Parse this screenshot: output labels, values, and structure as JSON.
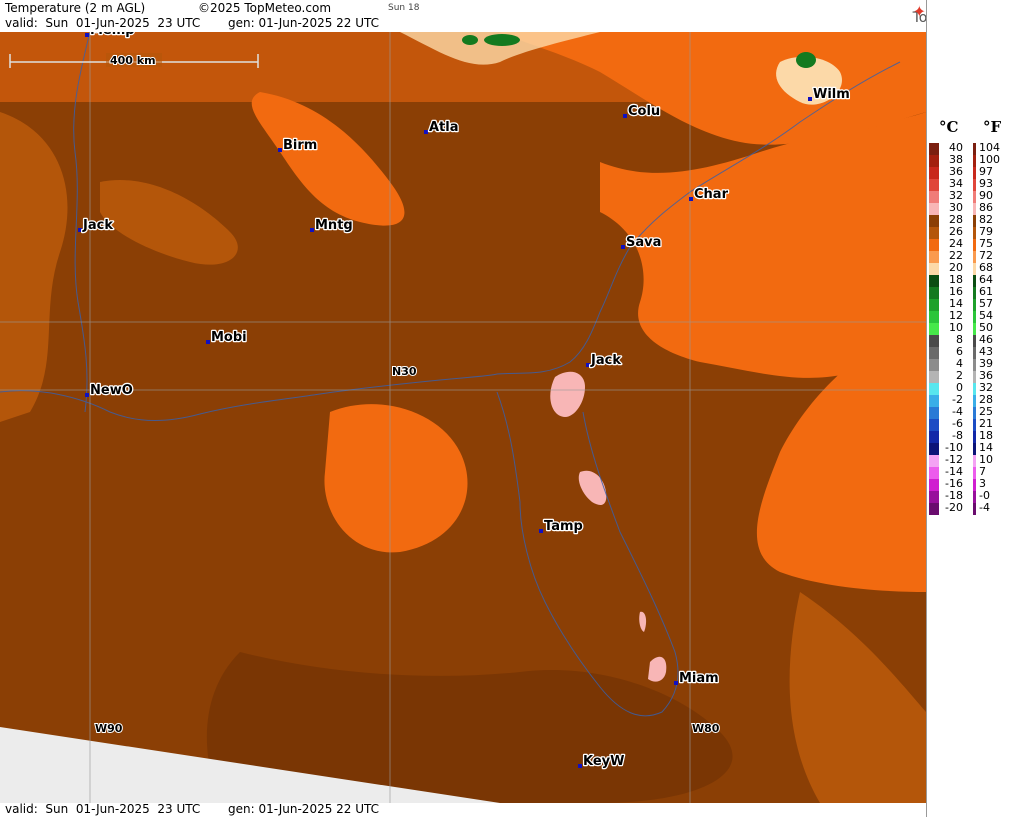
{
  "header": {
    "title": "Temperature (2 m AGL)",
    "copyright": "©2025 TopMeteo.com",
    "run": "Sun 18",
    "valid": "valid:  Sun  01-Jun-2025  23 UTC",
    "gen": "gen: 01-Jun-2025 22 UTC",
    "brand": "TopMeteo"
  },
  "footer": {
    "valid": "valid:  Sun  01-Jun-2025  23 UTC",
    "gen": "gen: 01-Jun-2025 22 UTC"
  },
  "map": {
    "scale_label": "400 km",
    "grid_labels": {
      "lat": "N30",
      "lon_w90": "W90",
      "lon_w80": "W80"
    },
    "cities": [
      {
        "name": "Memp"
      },
      {
        "name": "Birm"
      },
      {
        "name": "Atla"
      },
      {
        "name": "Colu"
      },
      {
        "name": "Wilm"
      },
      {
        "name": "Jack"
      },
      {
        "name": "Mntg"
      },
      {
        "name": "Char"
      },
      {
        "name": "Sava"
      },
      {
        "name": "Mobi"
      },
      {
        "name": "Jack"
      },
      {
        "name": "N30"
      },
      {
        "name": "NewO"
      },
      {
        "name": "Tamp"
      },
      {
        "name": "Miam"
      },
      {
        "name": "KeyW"
      }
    ]
  },
  "legend": {
    "celsius_label": "°C",
    "fahrenheit_label": "°F",
    "rows": [
      {
        "c": "40",
        "f": "104",
        "color": "#7b1f10"
      },
      {
        "c": "38",
        "f": "100",
        "color": "#a3200f"
      },
      {
        "c": "36",
        "f": "97",
        "color": "#c8281c"
      },
      {
        "c": "34",
        "f": "93",
        "color": "#e0463a"
      },
      {
        "c": "32",
        "f": "90",
        "color": "#f07c78"
      },
      {
        "c": "30",
        "f": "86",
        "color": "#f8b6b6"
      },
      {
        "c": "28",
        "f": "82",
        "color": "#8b3f05"
      },
      {
        "c": "26",
        "f": "79",
        "color": "#b4560a"
      },
      {
        "c": "24",
        "f": "75",
        "color": "#f26a10"
      },
      {
        "c": "22",
        "f": "72",
        "color": "#fa9a4e"
      },
      {
        "c": "20",
        "f": "68",
        "color": "#fcd9a8"
      },
      {
        "c": "18",
        "f": "64",
        "color": "#0b4d12"
      },
      {
        "c": "16",
        "f": "61",
        "color": "#147a1f"
      },
      {
        "c": "14",
        "f": "57",
        "color": "#1ea12b"
      },
      {
        "c": "12",
        "f": "54",
        "color": "#2bc53a"
      },
      {
        "c": "10",
        "f": "50",
        "color": "#46e84a"
      },
      {
        "c": "8",
        "f": "46",
        "color": "#4a4a4a"
      },
      {
        "c": "6",
        "f": "43",
        "color": "#6a6a6a"
      },
      {
        "c": "4",
        "f": "39",
        "color": "#8c8c8c"
      },
      {
        "c": "2",
        "f": "36",
        "color": "#b4b4b4"
      },
      {
        "c": "0",
        "f": "32",
        "color": "#58e6ee"
      },
      {
        "c": "-2",
        "f": "28",
        "color": "#3aaee8"
      },
      {
        "c": "-4",
        "f": "25",
        "color": "#2a7ad6"
      },
      {
        "c": "-6",
        "f": "21",
        "color": "#1c4cc4"
      },
      {
        "c": "-8",
        "f": "18",
        "color": "#1228a8"
      },
      {
        "c": "-10",
        "f": "14",
        "color": "#0c1478"
      },
      {
        "c": "-12",
        "f": "10",
        "color": "#f4a2f4"
      },
      {
        "c": "-14",
        "f": "7",
        "color": "#ec5cec"
      },
      {
        "c": "-16",
        "f": "3",
        "color": "#d01ed0"
      },
      {
        "c": "-18",
        "f": "-0",
        "color": "#98109c"
      },
      {
        "c": "-20",
        "f": "-4",
        "color": "#6a0c6e"
      }
    ]
  }
}
